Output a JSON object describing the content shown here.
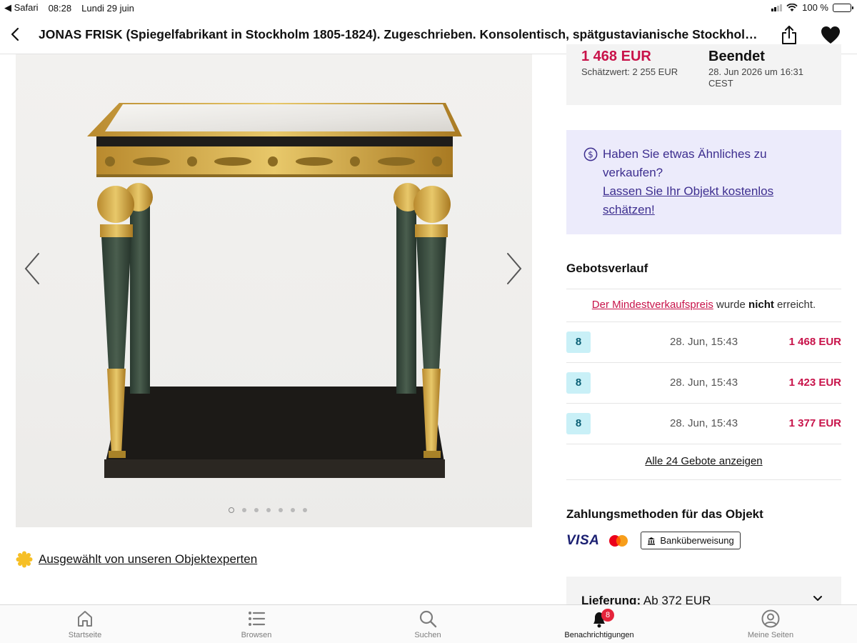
{
  "status_bar": {
    "back_app": "◀ Safari",
    "time": "08:28",
    "date": "Lundi 29 juin",
    "battery": "100 %"
  },
  "nav": {
    "title": "JONAS FRISK (Spiegelfabrikant in Stockholm 1805-1824). Zugeschrieben. Konsolentisch, spätgustavianische Stockholm Arbeit"
  },
  "gallery": {
    "image_count": 7,
    "active_index": 0
  },
  "expert": {
    "label": "Ausgewählt von unseren Objektexperten"
  },
  "price": {
    "current": "1 468 EUR",
    "estimate": "Schätzwert: 2 255 EUR",
    "status": "Beendet",
    "end_date": "28. Jun 2026 um 16:31 CEST"
  },
  "sell": {
    "question": "Haben Sie etwas Ähnliches zu verkaufen?",
    "link": "Lassen Sie Ihr Objekt kostenlos schätzen!"
  },
  "bids": {
    "title": "Gebotsverlauf",
    "reserve_link": "Der Mindestverkaufspreis",
    "reserve_mid": " wurde ",
    "reserve_not": "nicht",
    "reserve_end": " erreicht.",
    "rows": [
      {
        "bidder": "8",
        "time": "28. Jun, 15:43",
        "amount": "1 468 EUR"
      },
      {
        "bidder": "8",
        "time": "28. Jun, 15:43",
        "amount": "1 423 EUR"
      },
      {
        "bidder": "8",
        "time": "28. Jun, 15:43",
        "amount": "1 377 EUR"
      }
    ],
    "show_all": "Alle 24 Gebote anzeigen"
  },
  "payment": {
    "title": "Zahlungsmethoden für das Objekt",
    "visa": "VISA",
    "bank": "Banküberweisung"
  },
  "shipping": {
    "label": "Lieferung:",
    "value": " Ab 372 EUR"
  },
  "tabs": {
    "home": "Startseite",
    "browse": "Browsen",
    "search": "Suchen",
    "notifications": "Benachrichtigungen",
    "notifications_badge": "8",
    "account": "Meine Seiten"
  },
  "colors": {
    "accent": "#c8134a",
    "sell_bg": "#ecebfb",
    "sell_text": "#3d2e8f",
    "bidder_bg": "#c9f0f7"
  }
}
